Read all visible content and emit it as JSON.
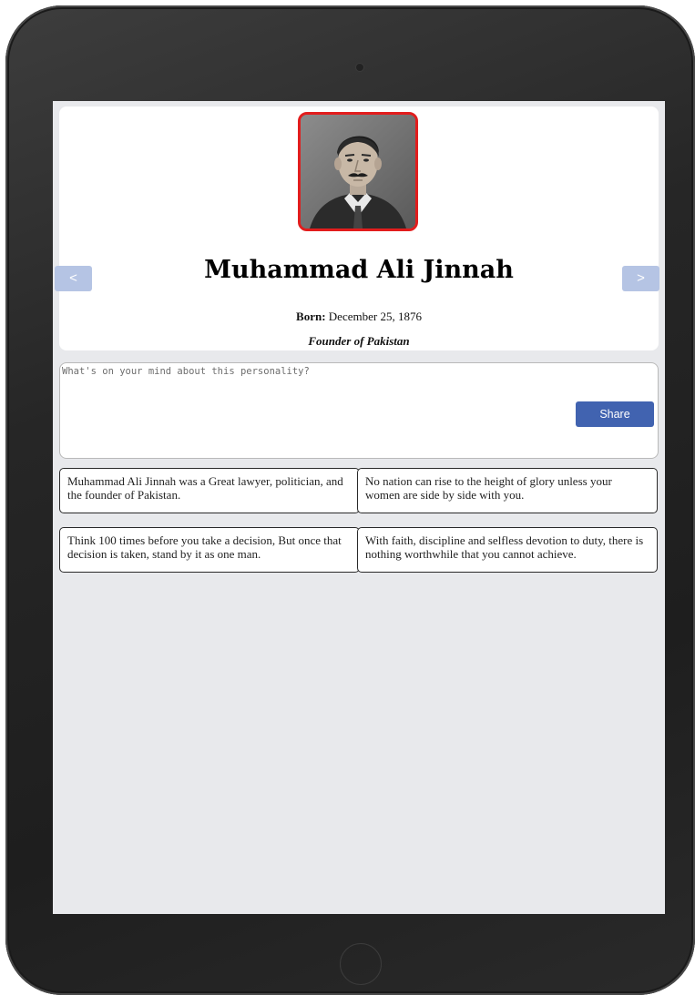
{
  "profile": {
    "name": "Muhammad Ali Jinnah",
    "born_label": "Born:",
    "born_date": "December 25, 1876",
    "title": "Founder of Pakistan",
    "photo_icon": "portrait-photo"
  },
  "navigation": {
    "prev_label": "<",
    "next_label": ">"
  },
  "post": {
    "placeholder": "What's on your mind about this personality?",
    "value": "",
    "share_label": "Share"
  },
  "quotes": [
    "Muhammad Ali Jinnah was a Great lawyer, politician, and the founder of Pakistan.",
    "No nation can rise to the height of glory unless your women are side by side with you.",
    "Think 100 times before you take a decision, But once that decision is taken, stand by it as one man.",
    "With faith, discipline and selfless devotion to duty, there is nothing worthwhile that you cannot achieve."
  ],
  "colors": {
    "accent": "#4163b0",
    "nav_button": "#b5c4e4",
    "photo_border": "#e21d1d",
    "screen_background": "#e8e9ec"
  }
}
